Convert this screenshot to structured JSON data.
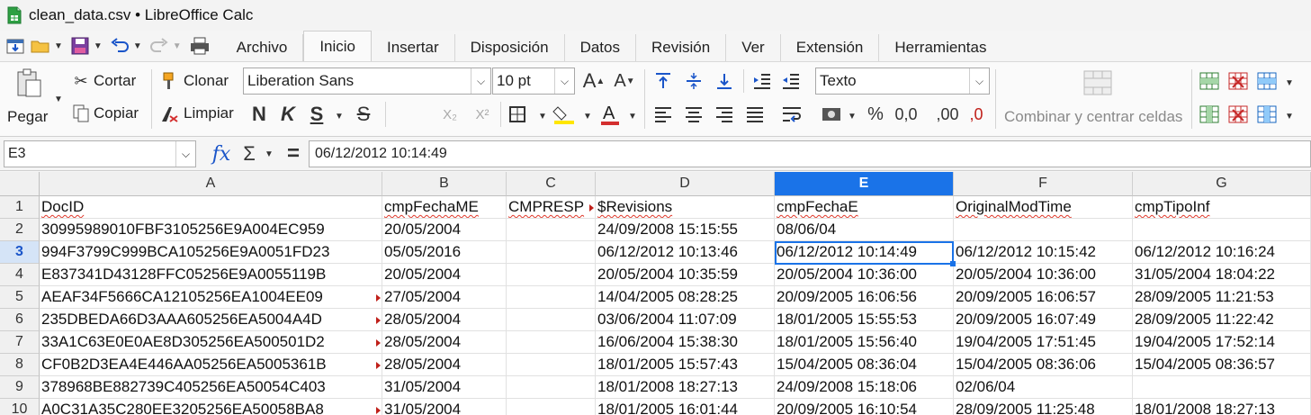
{
  "window": {
    "title": "clean_data.csv • LibreOffice Calc"
  },
  "menu": [
    "Archivo",
    "Inicio",
    "Insertar",
    "Disposición",
    "Datos",
    "Revisión",
    "Ver",
    "Extensión",
    "Herramientas"
  ],
  "menu_active": "Inicio",
  "ribbon": {
    "paste": "Pegar",
    "cut": "Cortar",
    "copy": "Copiar",
    "clone": "Clonar",
    "clear": "Limpiar",
    "font_name": "Liberation Sans",
    "font_size": "10 pt",
    "bold": "N",
    "italic": "K",
    "underline": "S",
    "strike": "S",
    "number_format": "Texto",
    "percent": "%",
    "decimal": "0,0",
    "add_decimal": ",00",
    "del_decimal": ",0",
    "merge_center": "Combinar y centrar celdas",
    "sub": "X₂",
    "sup": "X²",
    "grow": "A",
    "shrink": "A"
  },
  "formula_bar": {
    "name_box": "E3",
    "fx": "fx",
    "sum": "Σ",
    "equals": "=",
    "content": "06/12/2012 10:14:49"
  },
  "sheet": {
    "columns": [
      "A",
      "B",
      "C",
      "D",
      "E",
      "F",
      "G"
    ],
    "selected_column": "E",
    "rows": [
      "1",
      "2",
      "3",
      "4",
      "5",
      "6",
      "7",
      "8",
      "9",
      "10"
    ],
    "selected_row": "3",
    "cells": [
      [
        "DocID",
        "cmpFechaME",
        "CMPRESP",
        "$Revisions",
        "cmpFechaE",
        "OriginalModTime",
        "cmpTipoInf"
      ],
      [
        "30995989010FBF3105256E9A004EC959",
        "20/05/2004",
        "",
        "24/09/2008 15:15:55",
        "08/06/04",
        "",
        ""
      ],
      [
        "994F3799C999BCA105256E9A0051FD23",
        "05/05/2016",
        "",
        "06/12/2012 10:13:46",
        "06/12/2012 10:14:49",
        "06/12/2012 10:15:42",
        "06/12/2012 10:16:24"
      ],
      [
        "E837341D43128FFC05256E9A0055119B",
        "20/05/2004",
        "",
        "20/05/2004 10:35:59",
        "20/05/2004 10:36:00",
        "20/05/2004 10:36:00",
        "31/05/2004 18:04:22"
      ],
      [
        "AEAF34F5666CA12105256EA1004EE09",
        "27/05/2004",
        "",
        "14/04/2005 08:28:25",
        "20/09/2005 16:06:56",
        "20/09/2005 16:06:57",
        "28/09/2005 11:21:53"
      ],
      [
        "235DBEDA66D3AAA605256EA5004A4D",
        "28/05/2004",
        "",
        "03/06/2004 11:07:09",
        "18/01/2005 15:55:53",
        "20/09/2005 16:07:49",
        "28/09/2005 11:22:42"
      ],
      [
        "33A1C63E0E0AE8D305256EA500501D2",
        "28/05/2004",
        "",
        "16/06/2004 15:38:30",
        "18/01/2005 15:56:40",
        "19/04/2005 17:51:45",
        "19/04/2005 17:52:14"
      ],
      [
        "CF0B2D3EA4E446AA05256EA5005361B",
        "28/05/2004",
        "",
        "18/01/2005 15:57:43",
        "15/04/2005 08:36:04",
        "15/04/2005 08:36:06",
        "15/04/2005 08:36:57"
      ],
      [
        "378968BE882739C405256EA50054C403",
        "31/05/2004",
        "",
        "18/01/2008 18:27:13",
        "24/09/2008 15:18:06",
        "02/06/04",
        ""
      ],
      [
        "A0C31A35C280EE3205256EA50058BA8",
        "31/05/2004",
        "",
        "18/01/2005 16:01:44",
        "20/09/2005 16:10:54",
        "28/09/2005 11:25:48",
        "18/01/2008 18:27:13"
      ]
    ]
  },
  "colors": {
    "selection": "#1a73e8",
    "accent_red": "#c0201a",
    "accent_blue": "#1a55c9"
  }
}
